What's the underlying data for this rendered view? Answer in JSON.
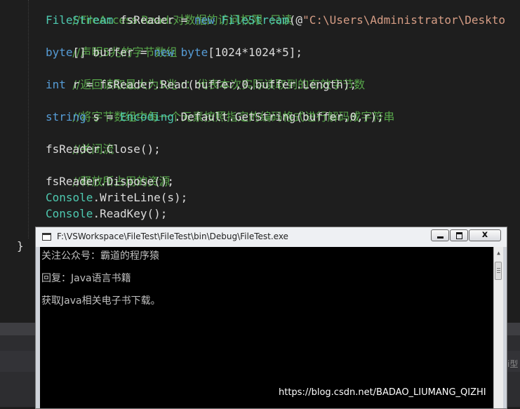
{
  "editor": {
    "lines": {
      "l0": "//FileAccess.Read:对数据的访问权限  只读",
      "l1_type": "FileStream",
      "l1_mid": " fsReader = ",
      "l1_new": "new",
      "l1_type2": "FileStream",
      "l1_rest": "(@",
      "l1_str": "\"C:\\Users\\Administrator\\Deskto",
      "l2": "//声明5兆的字节数组",
      "l3_kw": "byte",
      "l3_mid": "[] buffer = ",
      "l3_new": "new",
      "l3_kw2": "byte",
      "l3_rest": "[1024*1024*5];",
      "l4": "//返回读取最大为5兆 r：代表本次实际读取到的有效字节数",
      "l5_kw": "int",
      "l5_rest": " r = fsReader.Read(buffer,0,buffer.Length);",
      "l6": "//将字节数组中每一个元素按照指定的编码格式进行解码成字符串",
      "l7_kw": "string",
      "l7_mid": " s = ",
      "l7_type": "Encoding",
      "l7_rest": ".Default.GetString(buffer,0,r);",
      "l8": "//关闭流",
      "l9": "fsReader.Close();",
      "l10": "//释放所占用的资源",
      "l11": "fsReader.Dispose();",
      "l12_type": "Console",
      "l12_rest": ".WriteLine(s);",
      "l13_type": "Console",
      "l13_rest": ".ReadKey();"
    },
    "closing_brace": "}"
  },
  "console": {
    "title": "F:\\VSWorkspace\\FileTest\\FileTest\\bin\\Debug\\FileTest.exe",
    "close_label": "x",
    "output": [
      "关注公众号：霸道的程序猿",
      "回复：Java语言书籍",
      "获取Java相关电子书下载。"
    ]
  },
  "bottom_panel": {
    "side_text": "i型"
  },
  "watermark": "https://blog.csdn.net/BADAO_LIUMANG_QIZHI",
  "colors": {
    "editor_bg": "#1e1e1e",
    "keyword": "#569cd6",
    "type": "#4ec9b0",
    "comment": "#57a64a",
    "string": "#d69d85",
    "console_bg": "#000000"
  }
}
